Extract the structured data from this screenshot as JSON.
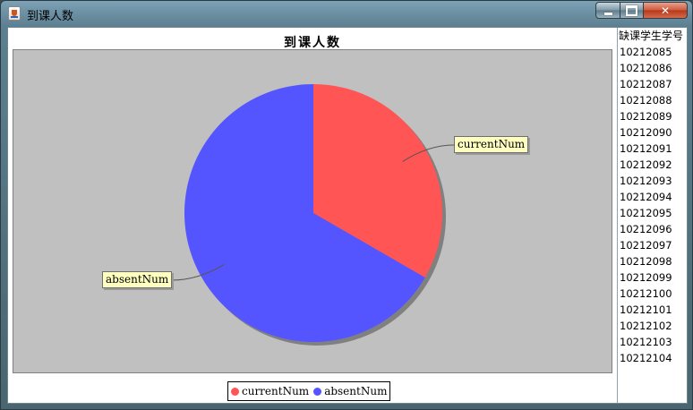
{
  "window": {
    "title": "到课人数",
    "icon": "java-cup-icon"
  },
  "chart_data": {
    "type": "pie",
    "title": "到课人数",
    "categories": [
      "currentNum",
      "absentNum"
    ],
    "values": [
      1,
      2
    ],
    "colors": [
      "#ff5555",
      "#5555ff"
    ],
    "legend_position": "bottom-center",
    "background": "#c0c0c0"
  },
  "side_list": {
    "header": "缺课学生学号",
    "items": [
      "10212085",
      "10212086",
      "10212087",
      "10212088",
      "10212089",
      "10212090",
      "10212091",
      "10212092",
      "10212093",
      "10212094",
      "10212095",
      "10212096",
      "10212097",
      "10212098",
      "10212099",
      "10212100",
      "10212101",
      "10212102",
      "10212103",
      "10212104"
    ]
  }
}
